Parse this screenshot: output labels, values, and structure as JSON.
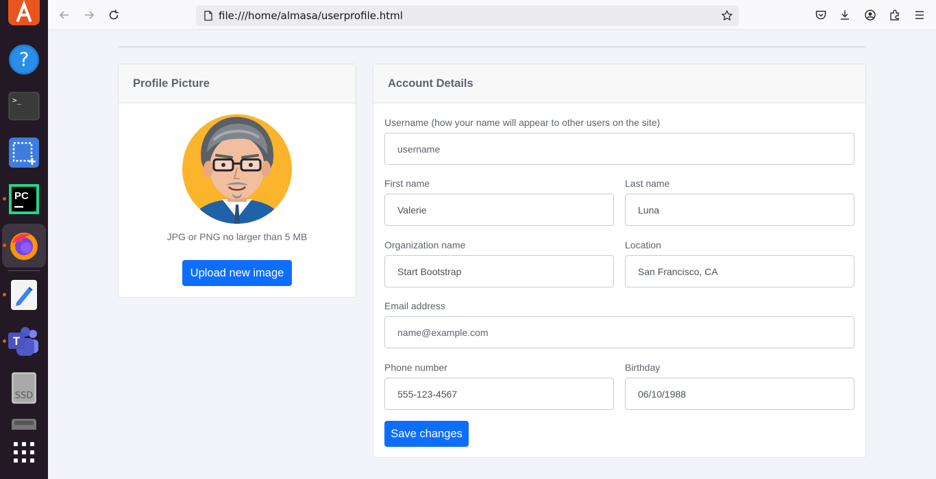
{
  "dock": {
    "items": [
      {
        "name": "app-center",
        "running": false
      },
      {
        "name": "help",
        "running": false
      },
      {
        "name": "terminal",
        "running": false
      },
      {
        "name": "screenshot",
        "running": false
      },
      {
        "name": "pycharm",
        "running": true
      },
      {
        "name": "firefox",
        "running": true,
        "active": true
      },
      {
        "name": "text-editor",
        "running": true
      },
      {
        "name": "teams",
        "running": true
      },
      {
        "name": "ssd-drive",
        "running": false
      },
      {
        "name": "drive",
        "running": false
      },
      {
        "name": "show-apps",
        "running": false
      }
    ],
    "terminal_prompt": ">_",
    "pycharm_label": "PC",
    "teams_label": "T",
    "ssd_label": "SSD",
    "help_label": "?"
  },
  "browser": {
    "url": "file:///home/almasa/userprofile.html"
  },
  "profile_card": {
    "header": "Profile Picture",
    "hint": "JPG or PNG no larger than 5 MB",
    "upload_label": "Upload new image"
  },
  "account_card": {
    "header": "Account Details",
    "username": {
      "label": "Username (how your name will appear to other users on the site)",
      "placeholder": "username",
      "value": ""
    },
    "first_name": {
      "label": "First name",
      "value": "Valerie"
    },
    "last_name": {
      "label": "Last name",
      "value": "Luna"
    },
    "organization": {
      "label": "Organization name",
      "value": "Start Bootstrap"
    },
    "location": {
      "label": "Location",
      "value": "San Francisco, CA"
    },
    "email": {
      "label": "Email address",
      "placeholder": "name@example.com",
      "value": ""
    },
    "phone": {
      "label": "Phone number",
      "value": "555-123-4567"
    },
    "birthday": {
      "label": "Birthday",
      "value": "06/10/1988"
    },
    "save_label": "Save changes"
  },
  "colors": {
    "primary": "#0d6efd",
    "dock_bg": "#221924",
    "ubuntu_orange": "#e95420"
  }
}
